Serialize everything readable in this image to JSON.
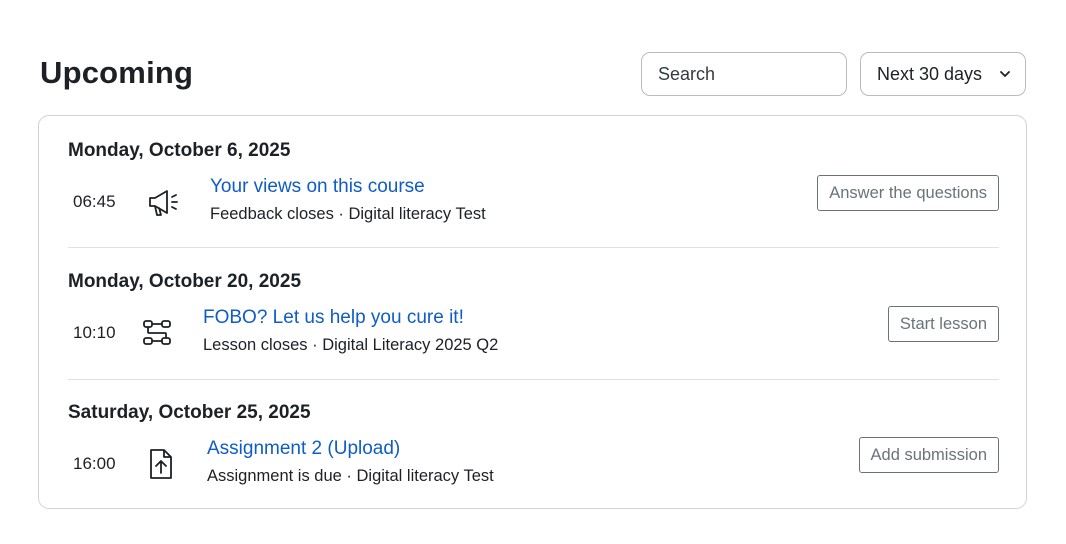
{
  "page": {
    "title": "Upcoming"
  },
  "controls": {
    "search_placeholder": "Search",
    "range_value": "Next 30 days"
  },
  "events": [
    {
      "date": "Monday, October 6, 2025",
      "time": "06:45",
      "icon": "megaphone-icon",
      "name": "Your views on this course",
      "meta": "Feedback closes · Digital literacy Test",
      "action": "Answer the questions"
    },
    {
      "date": "Monday, October 20, 2025",
      "time": "10:10",
      "icon": "lesson-icon",
      "name": "FOBO? Let us help you cure it!",
      "meta": "Lesson closes · Digital Literacy 2025 Q2",
      "action": "Start lesson"
    },
    {
      "date": "Saturday, October 25, 2025",
      "time": "16:00",
      "icon": "upload-file-icon",
      "name": "Assignment 2 (Upload)",
      "meta": "Assignment is due · Digital literacy Test",
      "action": "Add submission"
    }
  ],
  "colors": {
    "link": "#0f5cc7",
    "text": "#1d2125",
    "button_border": "#6a737b",
    "card_border": "#cfd3d8"
  }
}
